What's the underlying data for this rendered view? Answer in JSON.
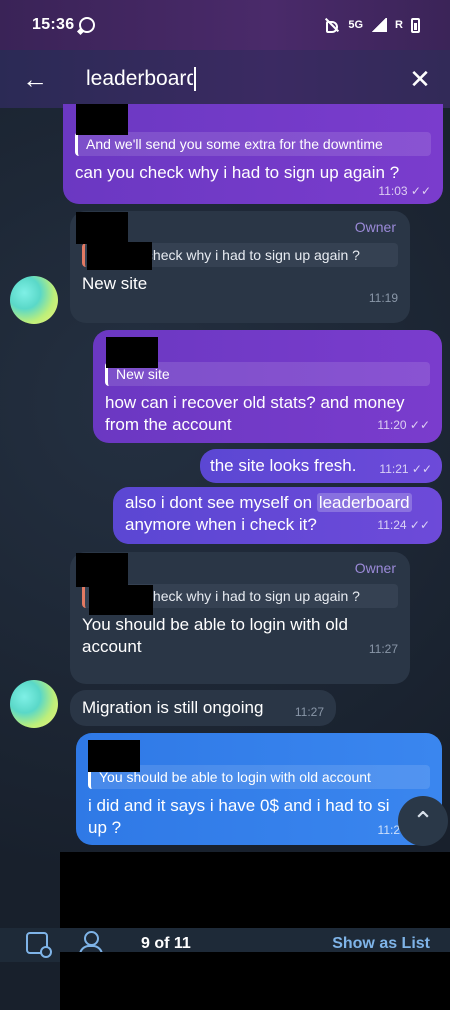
{
  "status_bar": {
    "time": "15:36",
    "network": "5G",
    "roaming": "R"
  },
  "search": {
    "query": "leaderboard",
    "back_icon": "←",
    "close_icon": "✕"
  },
  "messages": [
    {
      "reply": "And we'll send you some extra for the downtime",
      "text": "can you check why i had to sign up again ?",
      "time": "11:03",
      "status": "✓✓"
    },
    {
      "badge": "Owner",
      "reply": "can you check why i had to sign up again ?",
      "text": "New site",
      "time": "11:19"
    },
    {
      "reply": "New site",
      "text": "how can i recover old stats? and money from the account",
      "time": "11:20",
      "status": "✓✓"
    },
    {
      "text": "the site looks fresh.",
      "time": "11:21",
      "status": "✓✓"
    },
    {
      "text_before": "also i dont see myself on ",
      "text_highlight": "leaderboard",
      "text_after": "anymore when i check it?",
      "time": "11:24",
      "status": "✓✓"
    },
    {
      "badge": "Owner",
      "reply": "can you check why i had to sign up again ?",
      "text": "You should be able to login with old account",
      "time": "11:27"
    },
    {
      "text": "Migration is still ongoing",
      "time": "11:27"
    },
    {
      "reply": "You should be able to login with old account",
      "text": "i did and it says i have 0$ and i had to si up ?",
      "time": "11:2"
    }
  ],
  "scroll_icon": "⌃",
  "bottom_bar": {
    "counter": "9 of 11",
    "show_list": "Show as List"
  }
}
